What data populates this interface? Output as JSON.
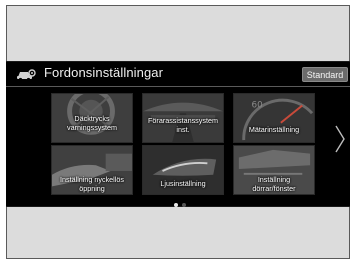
{
  "header": {
    "title": "Fordonsinställningar",
    "standard_label": "Standard"
  },
  "tiles": [
    {
      "label": "Däcktrycks\nvarningssystem"
    },
    {
      "label": "Förarassistanssystem\ninst."
    },
    {
      "label": "Mätarinställning"
    },
    {
      "label": "Inställning nyckellös\nöppning"
    },
    {
      "label": "Ljusinställning"
    },
    {
      "label": "Inställning\ndörrar/fönster"
    }
  ],
  "pagination": {
    "current_page": 1,
    "total_pages": 2
  },
  "colors": {
    "screen_bg": "#000000",
    "tile_bg": "#4a4a4a",
    "button_bg": "#6b6b6b",
    "dot_active": "#e8e8e8",
    "dot_inactive": "#555555"
  },
  "icons": {
    "header": "car-settings-icon",
    "next": "chevron-right-icon"
  }
}
